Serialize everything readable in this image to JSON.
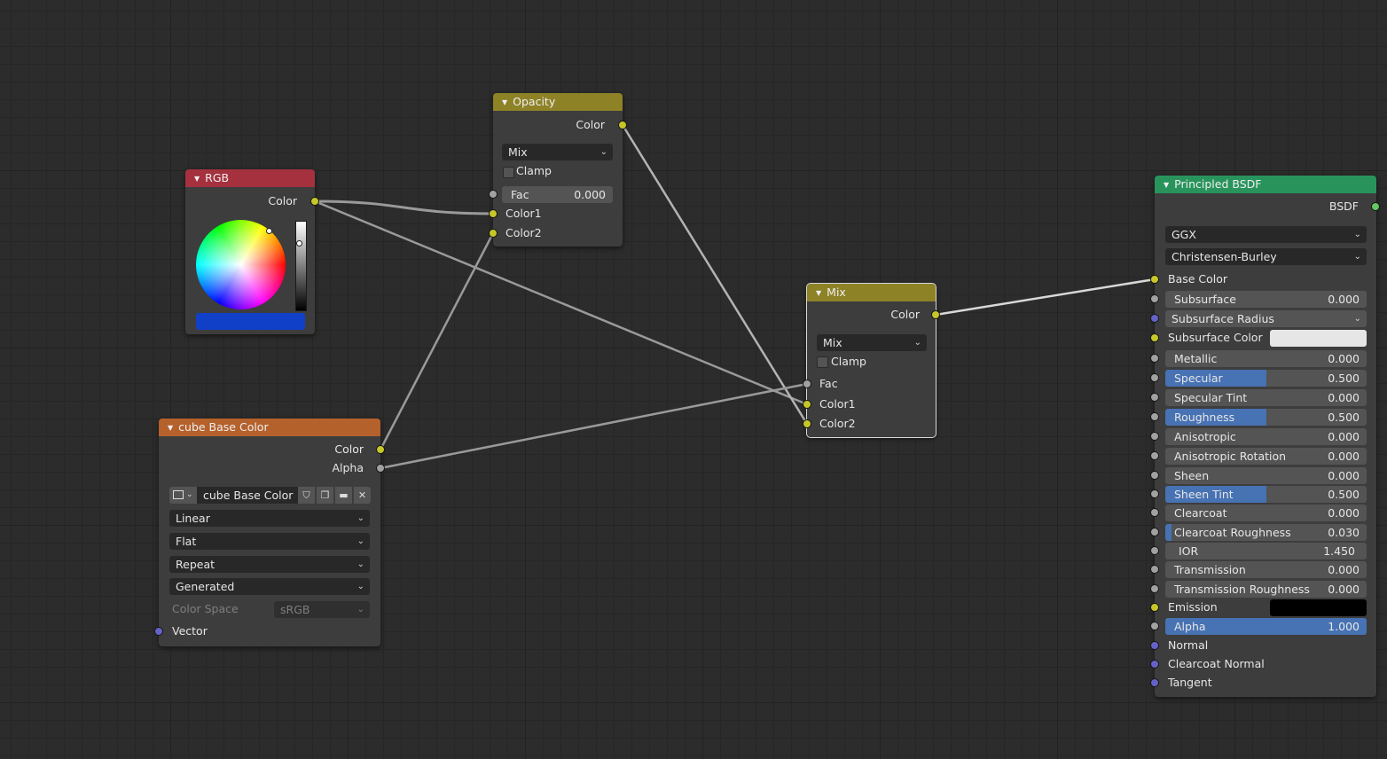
{
  "nodes": {
    "opacity": {
      "title": "Opacity",
      "output": "Color",
      "blend": "Mix",
      "clamp": "Clamp",
      "fac_label": "Fac",
      "fac_value": "0.000",
      "in1": "Color1",
      "in2": "Color2"
    },
    "rgb": {
      "title": "RGB",
      "output": "Color",
      "swatch_color": "#1140c8"
    },
    "mix": {
      "title": "Mix",
      "output": "Color",
      "blend": "Mix",
      "clamp": "Clamp",
      "in_fac": "Fac",
      "in1": "Color1",
      "in2": "Color2"
    },
    "image": {
      "title": "cube Base Color",
      "out_color": "Color",
      "out_alpha": "Alpha",
      "image_name": "cube Base Color",
      "interpolation": "Linear",
      "projection": "Flat",
      "extension": "Repeat",
      "source": "Generated",
      "color_space_label": "Color Space",
      "color_space": "sRGB",
      "in_vector": "Vector",
      "icons": [
        "image-browse-icon",
        "fake-user-shield-icon",
        "duplicate-icon",
        "folder-open-icon",
        "close-icon"
      ]
    },
    "bsdf": {
      "title": "Principled BSDF",
      "output": "BSDF",
      "distribution": "GGX",
      "subsurface_method": "Christensen-Burley",
      "base_color": "Base Color",
      "subsurface": {
        "label": "Subsurface",
        "value": "0.000",
        "fill": 0
      },
      "subsurface_radius": "Subsurface Radius",
      "subsurface_color": "Subsurface Color",
      "subsurface_color_hex": "#e6e6e6",
      "metallic": {
        "label": "Metallic",
        "value": "0.000",
        "fill": 0
      },
      "specular": {
        "label": "Specular",
        "value": "0.500",
        "fill": 0.5
      },
      "specular_tint": {
        "label": "Specular Tint",
        "value": "0.000",
        "fill": 0
      },
      "roughness": {
        "label": "Roughness",
        "value": "0.500",
        "fill": 0.5
      },
      "anisotropic": {
        "label": "Anisotropic",
        "value": "0.000",
        "fill": 0
      },
      "anisotropic_rotation": {
        "label": "Anisotropic Rotation",
        "value": "0.000",
        "fill": 0
      },
      "sheen": {
        "label": "Sheen",
        "value": "0.000",
        "fill": 0
      },
      "sheen_tint": {
        "label": "Sheen Tint",
        "value": "0.500",
        "fill": 0.5
      },
      "clearcoat": {
        "label": "Clearcoat",
        "value": "0.000",
        "fill": 0
      },
      "clearcoat_roughness": {
        "label": "Clearcoat Roughness",
        "value": "0.030",
        "fill": 0.03
      },
      "ior": {
        "label": "IOR",
        "value": "1.450"
      },
      "transmission": {
        "label": "Transmission",
        "value": "0.000",
        "fill": 0
      },
      "transmission_roughness": {
        "label": "Transmission Roughness",
        "value": "0.000",
        "fill": 0
      },
      "emission": "Emission",
      "emission_hex": "#000000",
      "alpha": {
        "label": "Alpha",
        "value": "1.000",
        "fill": 1
      },
      "normal": "Normal",
      "clearcoat_normal": "Clearcoat Normal",
      "tangent": "Tangent"
    }
  },
  "colors": {
    "header_color_node": "#8e8227",
    "header_input_node": "#a5313f",
    "header_texture_node": "#b5612b",
    "header_shader_node": "#28945c",
    "slider_fill": "#4772b3"
  }
}
